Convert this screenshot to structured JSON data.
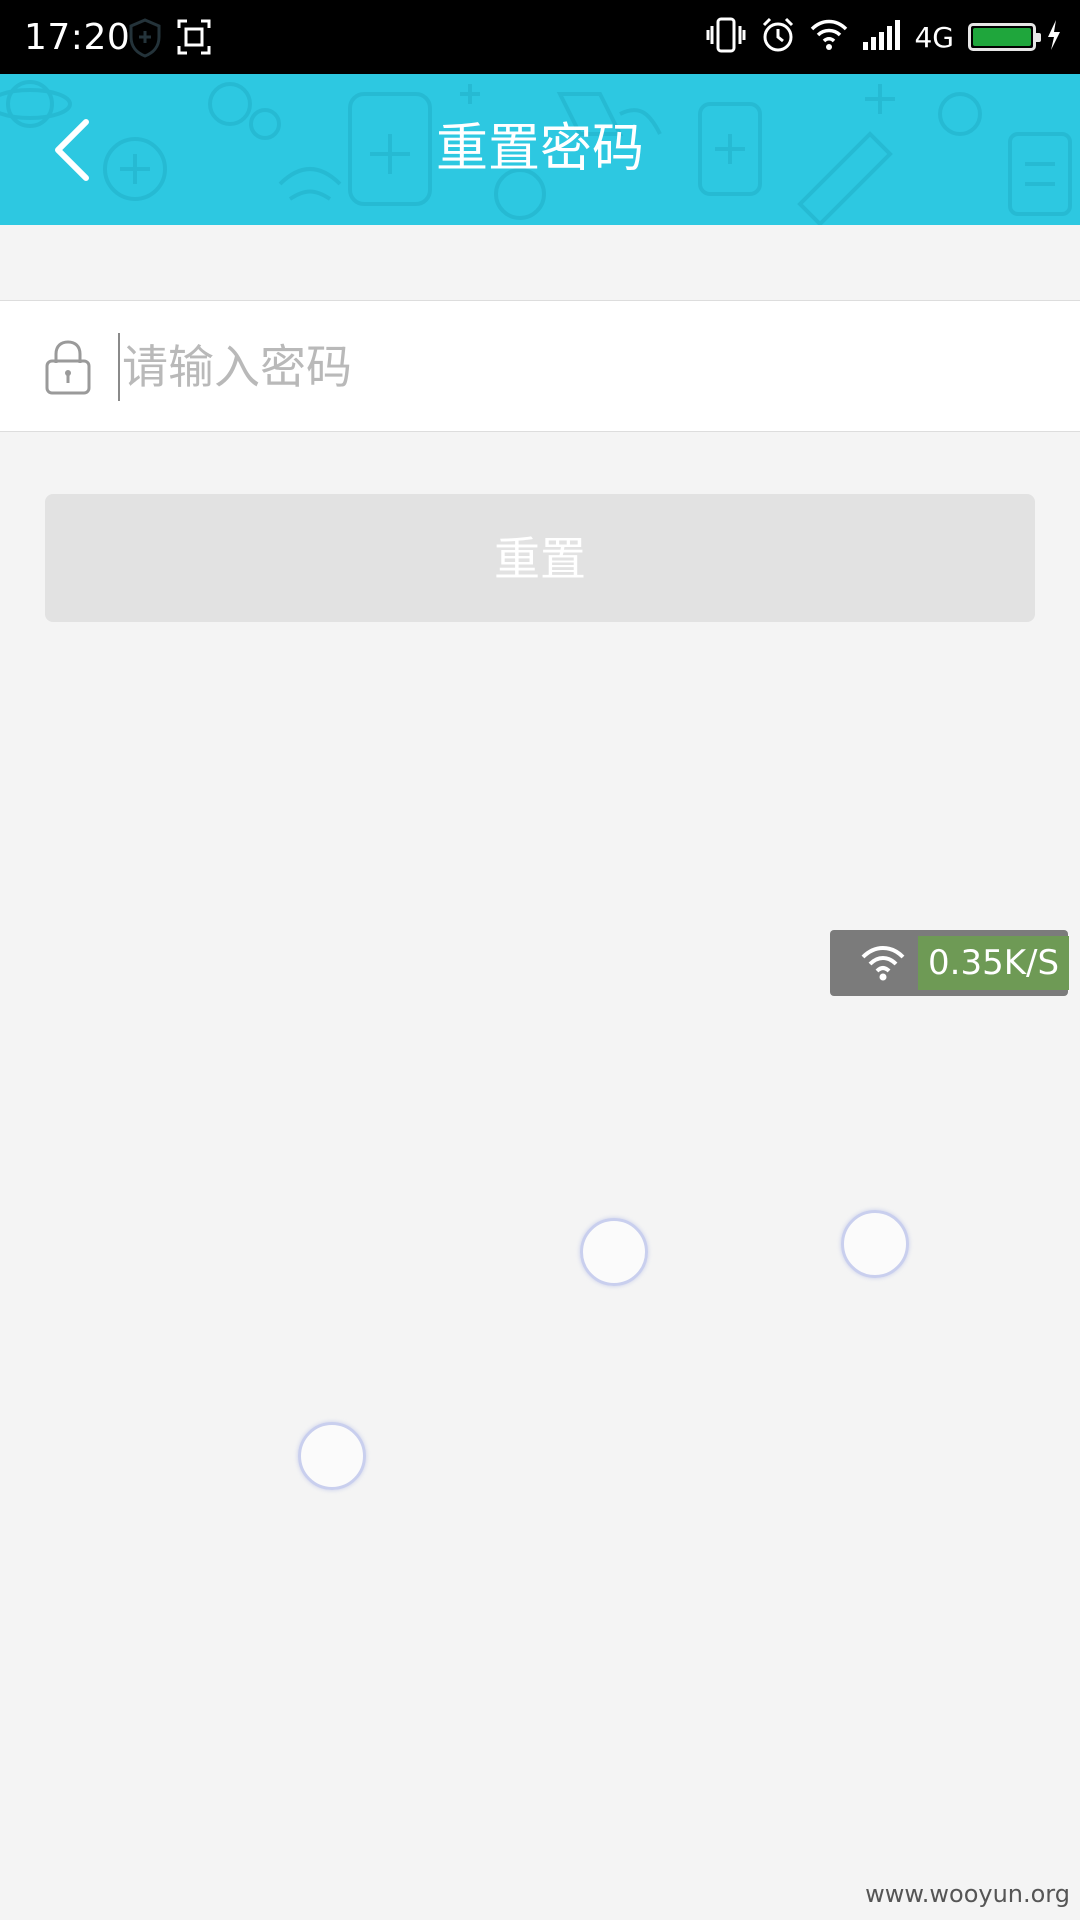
{
  "status_bar": {
    "time": "17:20",
    "network_type": "4G",
    "icons": [
      "shield-icon",
      "screenshot-icon",
      "vibrate-icon",
      "alarm-icon",
      "wifi-icon",
      "cellular-signal-icon",
      "battery-icon",
      "charging-icon"
    ],
    "battery_color": "#1fa63c"
  },
  "header": {
    "title": "重置密码",
    "back_icon": "chevron-left-icon",
    "background_color": "#2dc8e1"
  },
  "password_field": {
    "placeholder": "请输入密码",
    "value": "",
    "icon": "lock-icon"
  },
  "reset_button": {
    "label": "重置",
    "background_color": "#e2e2e2",
    "enabled": false
  },
  "speed_widget": {
    "speed": "0.35K/S",
    "icon": "wifi-icon"
  },
  "watermark": "www.wooyun.org"
}
